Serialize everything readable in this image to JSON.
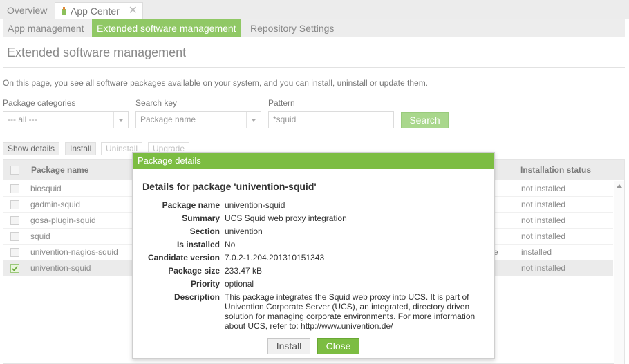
{
  "top_tabs": [
    {
      "label": "Overview"
    },
    {
      "label": "App Center"
    }
  ],
  "sub_tabs": [
    {
      "label": "App management"
    },
    {
      "label": "Extended software management"
    },
    {
      "label": "Repository Settings"
    }
  ],
  "page": {
    "title": "Extended software management",
    "intro": "On this page, you see all software packages available on your system, and you can install, uninstall or update them."
  },
  "filters": {
    "categories_label": "Package categories",
    "categories_value": "--- all ---",
    "searchkey_label": "Search key",
    "searchkey_value": "Package name",
    "pattern_label": "Pattern",
    "pattern_value": "*squid",
    "search_button": "Search"
  },
  "toolbar": {
    "show_details": "Show details",
    "install": "Install",
    "uninstall": "Uninstall",
    "upgrade": "Upgrade"
  },
  "grid": {
    "col_name": "Package name",
    "col_status": "Installation status",
    "rows": [
      {
        "name": "biosquid",
        "status": "not installed",
        "checked": false
      },
      {
        "name": "gadmin-squid",
        "status": "not installed",
        "checked": false
      },
      {
        "name": "gosa-plugin-squid",
        "status": "not installed",
        "checked": false
      },
      {
        "name": "squid",
        "status": "not installed",
        "checked": false
      },
      {
        "name": "univention-nagios-squid",
        "status": "installed",
        "partial": "e",
        "checked": false
      },
      {
        "name": "univention-squid",
        "status": "not installed",
        "checked": true
      }
    ]
  },
  "dialog": {
    "title": "Package details",
    "heading": "Details for package 'univention-squid'",
    "fields": [
      {
        "label": "Package name",
        "value": "univention-squid"
      },
      {
        "label": "Summary",
        "value": "UCS Squid web proxy integration"
      },
      {
        "label": "Section",
        "value": "univention"
      },
      {
        "label": "Is installed",
        "value": "No"
      },
      {
        "label": "Candidate version",
        "value": "7.0.2-1.204.201310151343"
      },
      {
        "label": "Package size",
        "value": "233.47 kB"
      },
      {
        "label": "Priority",
        "value": "optional"
      }
    ],
    "description_label": "Description",
    "description_lines": [
      "This package integrates the Squid web proxy into UCS. It is part of",
      "Univention Corporate Server (UCS), an integrated, directory driven",
      "solution for managing corporate environments. For more information",
      "about UCS, refer to: http://www.univention.de/"
    ],
    "install_button": "Install",
    "close_button": "Close"
  },
  "colors": {
    "accent": "#7cbd42",
    "subtab_active": "#90c865",
    "search_button": "#a9d78c"
  }
}
